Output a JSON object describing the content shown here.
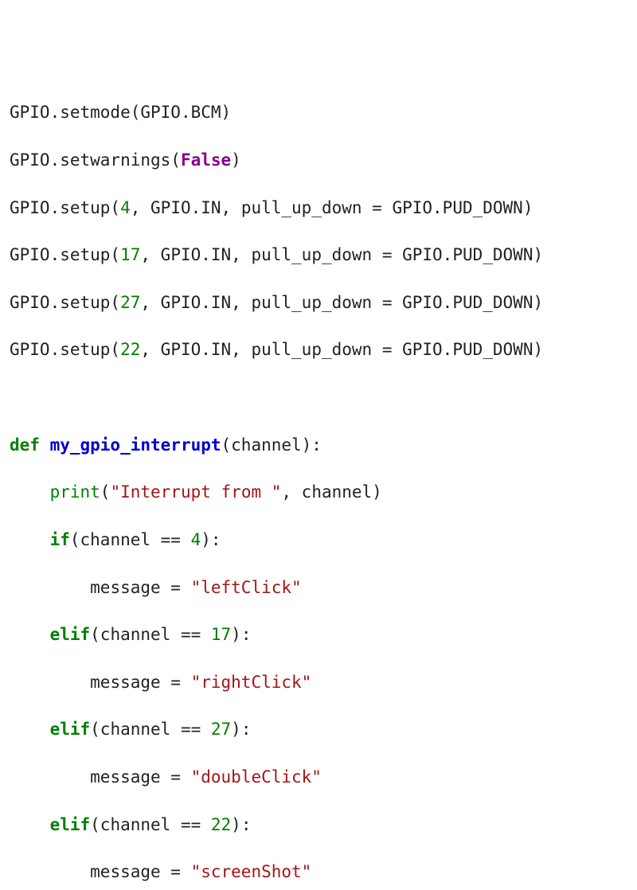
{
  "code": {
    "l1": {
      "a": "GPIO",
      "b": ".setmode(GPIO.BCM)"
    },
    "l2": {
      "a": "GPIO",
      "b": ".setwarnings(",
      "false": "False",
      "c": ")"
    },
    "l3": {
      "a": "GPIO",
      "b": ".setup(",
      "n": "4",
      "c": ", GPIO.IN, pull_up_down = GPIO.PUD_DOWN)"
    },
    "l4": {
      "a": "GPIO",
      "b": ".setup(",
      "n": "17",
      "c": ", GPIO.IN, pull_up_down = GPIO.PUD_DOWN)"
    },
    "l5": {
      "a": "GPIO",
      "b": ".setup(",
      "n": "27",
      "c": ", GPIO.IN, pull_up_down = GPIO.PUD_DOWN)"
    },
    "l6": {
      "a": "GPIO",
      "b": ".setup(",
      "n": "22",
      "c": ", GPIO.IN, pull_up_down = GPIO.PUD_DOWN)"
    },
    "l8": {
      "def": "def ",
      "fn": "my_gpio_interrupt",
      "rest": "(channel):"
    },
    "l9": {
      "indent": "    ",
      "print": "print",
      "open": "(",
      "str": "\"Interrupt from \"",
      "rest": ", channel)"
    },
    "l10": {
      "indent": "    ",
      "kw": "if",
      "open": "(channel == ",
      "n": "4",
      "close": "):"
    },
    "l11": {
      "indent": "        ",
      "a": "message = ",
      "str": "\"leftClick\""
    },
    "l12": {
      "indent": "    ",
      "kw": "elif",
      "open": "(channel == ",
      "n": "17",
      "close": "):"
    },
    "l13": {
      "indent": "        ",
      "a": "message = ",
      "str": "\"rightClick\""
    },
    "l14": {
      "indent": "    ",
      "kw": "elif",
      "open": "(channel == ",
      "n": "27",
      "close": "):"
    },
    "l15": {
      "indent": "        ",
      "a": "message = ",
      "str": "\"doubleClick\""
    },
    "l16": {
      "indent": "    ",
      "kw": "elif",
      "open": "(channel == ",
      "n": "22",
      "close": "):"
    },
    "l17": {
      "indent": "        ",
      "a": "message = ",
      "str": "\"screenShot\""
    }
  }
}
